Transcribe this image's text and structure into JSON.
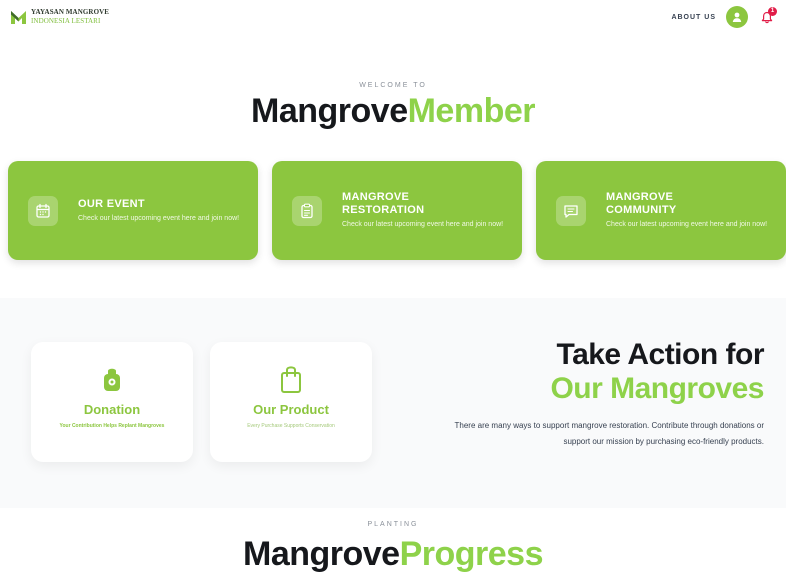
{
  "header": {
    "logo_line1": "YAYASAN MANGROVE",
    "logo_line2": "INDONESIA LESTARI",
    "about": "ABOUT US",
    "notification_count": "1"
  },
  "hero": {
    "eyebrow": "WELCOME TO",
    "title_dark": "Mangrove",
    "title_green": "Member"
  },
  "cards": [
    {
      "icon": "calendar-icon",
      "title": "OUR EVENT",
      "desc": "Check our latest upcoming event here and join now!"
    },
    {
      "icon": "clipboard-icon",
      "title": "MANGROVE RESTORATION",
      "desc": "Check our latest upcoming event here and join now!"
    },
    {
      "icon": "message-icon",
      "title": "MANGROVE COMMUNITY",
      "desc": "Check our latest upcoming event here and join now!"
    }
  ],
  "action": {
    "heading_dark": "Take Action for",
    "heading_green": "Our Mangroves",
    "text": "There are many ways to support mangrove restoration. Contribute through donations or support our mission by purchasing eco-friendly products.",
    "donation_title": "Donation",
    "donation_sub": "Your Contribution Helps Replant Mangroves",
    "product_title": "Our Product",
    "product_sub": "Every Purchase Supports Conservation"
  },
  "progress": {
    "eyebrow": "PLANTING",
    "title_dark": "Mangrove",
    "title_green": "Progress"
  },
  "colors": {
    "brand_green": "#8cc63f",
    "accent_green": "#8ed24a",
    "dark": "#16181c",
    "badge_red": "#e11d48"
  }
}
